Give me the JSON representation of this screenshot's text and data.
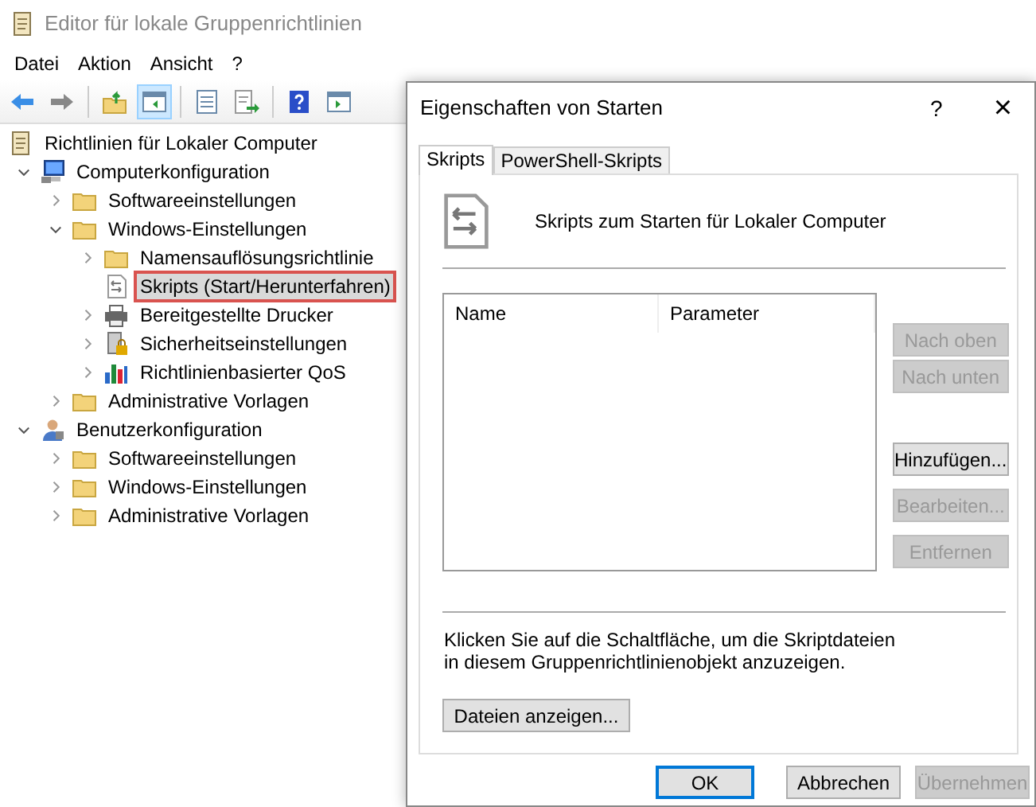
{
  "window": {
    "title": "Editor für lokale Gruppenrichtlinien"
  },
  "menu": [
    "Datei",
    "Aktion",
    "Ansicht",
    "?"
  ],
  "toolbar": [
    {
      "kind": "back",
      "pressed": false
    },
    {
      "kind": "forward",
      "pressed": false
    },
    {
      "kind": "separator"
    },
    {
      "kind": "up",
      "pressed": false
    },
    {
      "kind": "tree",
      "pressed": true
    },
    {
      "kind": "separator"
    },
    {
      "kind": "properties",
      "pressed": false
    },
    {
      "kind": "export",
      "pressed": false
    },
    {
      "kind": "separator"
    },
    {
      "kind": "help",
      "pressed": false
    },
    {
      "kind": "pane",
      "pressed": false
    }
  ],
  "tree": [
    {
      "label": "Richtlinien für Lokaler Computer",
      "kind": "policy",
      "selected": false,
      "children": [
        {
          "label": "Computerkonfiguration",
          "kind": "computer",
          "expanded": true,
          "selected": false,
          "children": [
            {
              "label": "Softwareeinstellungen",
              "kind": "folder",
              "expanded": false,
              "selected": false
            },
            {
              "label": "Windows-Einstellungen",
              "kind": "folder",
              "expanded": true,
              "selected": false,
              "children": [
                {
                  "label": "Namensauflösungsrichtlinie",
                  "kind": "folder",
                  "expanded": false,
                  "selected": false
                },
                {
                  "label": "Skripts (Start/Herunterfahren)",
                  "kind": "script",
                  "selected": true,
                  "highlighted": true
                },
                {
                  "label": "Bereitgestellte Drucker",
                  "kind": "printer",
                  "expanded": false,
                  "selected": false
                },
                {
                  "label": "Sicherheitseinstellungen",
                  "kind": "security",
                  "expanded": false,
                  "selected": false
                },
                {
                  "label": "Richtlinienbasierter QoS",
                  "kind": "chart",
                  "expanded": false,
                  "selected": false
                }
              ]
            },
            {
              "label": "Administrative Vorlagen",
              "kind": "folder",
              "expanded": false,
              "selected": false
            }
          ]
        },
        {
          "label": "Benutzerkonfiguration",
          "kind": "user",
          "expanded": true,
          "selected": false,
          "children": [
            {
              "label": "Softwareeinstellungen",
              "kind": "folder",
              "expanded": false,
              "selected": false
            },
            {
              "label": "Windows-Einstellungen",
              "kind": "folder",
              "expanded": false,
              "selected": false
            },
            {
              "label": "Administrative Vorlagen",
              "kind": "folder",
              "expanded": false,
              "selected": false
            }
          ]
        }
      ]
    }
  ],
  "dialog": {
    "title": "Eigenschaften von Starten",
    "help": "?",
    "close": "×",
    "tabs": [
      {
        "label": "Skripts",
        "selected": true
      },
      {
        "label": "PowerShell-Skripts",
        "selected": false
      }
    ],
    "heading": "Skripts zum Starten für Lokaler Computer",
    "table": {
      "columns": [
        "Name",
        "Parameter"
      ]
    },
    "side_buttons": [
      {
        "label": "Nach oben",
        "disabled": true
      },
      {
        "label": "Nach unten",
        "disabled": true
      },
      {
        "label": "Hinzufügen...",
        "disabled": false
      },
      {
        "label": "Bearbeiten...",
        "disabled": true
      },
      {
        "label": "Entfernen",
        "disabled": true
      }
    ],
    "info": "Klicken Sie auf die Schaltfläche, um die Skriptdateien in diesem Gruppenrichtlinienobjekt anzuzeigen.",
    "show_files_button": "Dateien anzeigen...",
    "footer_buttons": [
      {
        "label": "OK",
        "default": true,
        "disabled": false
      },
      {
        "label": "Abbrechen",
        "default": false,
        "disabled": false
      },
      {
        "label": "Übernehmen",
        "default": false,
        "disabled": true
      }
    ]
  }
}
